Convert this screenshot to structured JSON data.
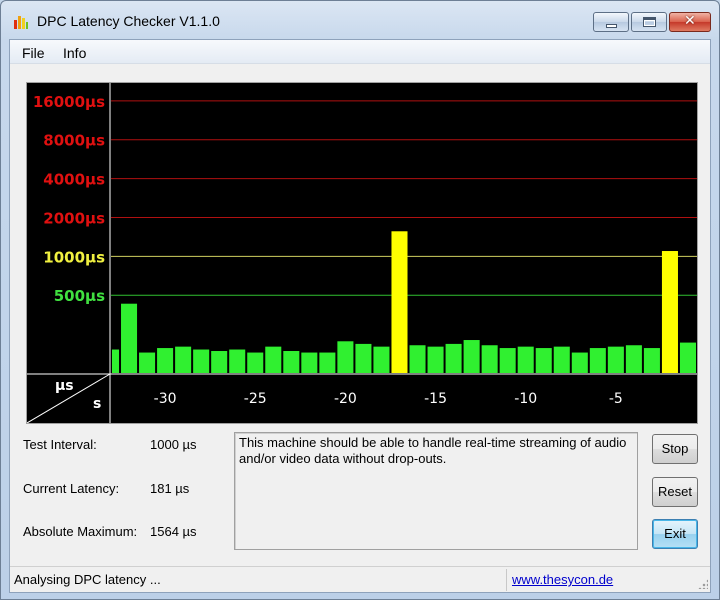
{
  "window": {
    "title": "DPC Latency Checker V1.1.0",
    "close_glyph": "✕"
  },
  "menu": {
    "items": [
      {
        "label": "File"
      },
      {
        "label": "Info"
      }
    ]
  },
  "chart_data": {
    "type": "bar",
    "ylabel": "µs",
    "xlabel": "s",
    "y_scale": "log2",
    "y_ticks": [
      {
        "label": "16000µs",
        "value": 16000,
        "color": "#e01010",
        "line": "#b01010"
      },
      {
        "label": "8000µs",
        "value": 8000,
        "color": "#e01010",
        "line": "#b01010"
      },
      {
        "label": "4000µs",
        "value": 4000,
        "color": "#e01010",
        "line": "#b01010"
      },
      {
        "label": "2000µs",
        "value": 2000,
        "color": "#e01010",
        "line": "#b01010"
      },
      {
        "label": "1000µs",
        "value": 1000,
        "color": "#f0f040",
        "line": "#d0d060"
      },
      {
        "label": "500µs",
        "value": 500,
        "color": "#40e040",
        "line": "#30c030"
      }
    ],
    "x_ticks": [
      -30,
      -25,
      -20,
      -15,
      -10,
      -5
    ],
    "x_range": [
      -33,
      -0.5
    ],
    "y_range": [
      125,
      22000
    ],
    "values": [
      190,
      430,
      180,
      195,
      200,
      190,
      185,
      190,
      180,
      200,
      185,
      180,
      180,
      220,
      210,
      200,
      1564,
      205,
      200,
      210,
      225,
      205,
      195,
      200,
      195,
      200,
      180,
      195,
      200,
      205,
      195,
      1100,
      215
    ],
    "bar_colors": {
      "normal": "#30f030",
      "warning": "#ffff00"
    },
    "warning_threshold": 1000,
    "background": "#000000"
  },
  "info": {
    "test_interval_label": "Test Interval:",
    "test_interval_value": "1000 µs",
    "current_latency_label": "Current Latency:",
    "current_latency_value": "181 µs",
    "absolute_max_label": "Absolute Maximum:",
    "absolute_max_value": "1564 µs"
  },
  "message": "This machine should be able to handle real-time streaming of audio and/or video data without drop-outs.",
  "buttons": {
    "stop": "Stop",
    "reset": "Reset",
    "exit": "Exit"
  },
  "status": {
    "text": "Analysing DPC latency ...",
    "link": "www.thesycon.de"
  }
}
